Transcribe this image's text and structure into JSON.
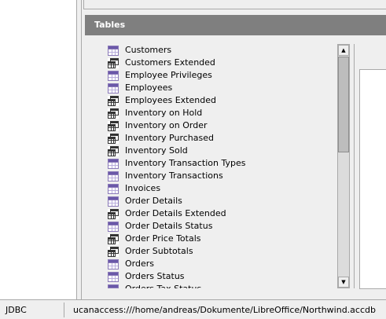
{
  "tables_section": {
    "title": "Tables",
    "items": [
      {
        "label": "Customers",
        "kind": "table"
      },
      {
        "label": "Customers Extended",
        "kind": "query"
      },
      {
        "label": "Employee Privileges",
        "kind": "table"
      },
      {
        "label": "Employees",
        "kind": "table"
      },
      {
        "label": "Employees Extended",
        "kind": "query"
      },
      {
        "label": "Inventory on Hold",
        "kind": "query"
      },
      {
        "label": "Inventory on Order",
        "kind": "query"
      },
      {
        "label": "Inventory Purchased",
        "kind": "query"
      },
      {
        "label": "Inventory Sold",
        "kind": "query"
      },
      {
        "label": "Inventory Transaction Types",
        "kind": "table"
      },
      {
        "label": "Inventory Transactions",
        "kind": "table"
      },
      {
        "label": "Invoices",
        "kind": "table"
      },
      {
        "label": "Order Details",
        "kind": "table"
      },
      {
        "label": "Order Details Extended",
        "kind": "query"
      },
      {
        "label": "Order Details Status",
        "kind": "table"
      },
      {
        "label": "Order Price Totals",
        "kind": "query"
      },
      {
        "label": "Order Subtotals",
        "kind": "query"
      },
      {
        "label": "Orders",
        "kind": "table"
      },
      {
        "label": "Orders Status",
        "kind": "table"
      },
      {
        "label": "Orders Tax Status",
        "kind": "table"
      }
    ],
    "scroll_up_icon": "▲",
    "scroll_down_icon": "▼"
  },
  "statusbar": {
    "connection_type": "JDBC",
    "connection_url": "ucanaccess:///home/andreas/Dokumente/LibreOffice/Northwind.accdb"
  },
  "colors": {
    "header_bg": "#7f7f7f",
    "table_icon": "#6a58a8"
  }
}
